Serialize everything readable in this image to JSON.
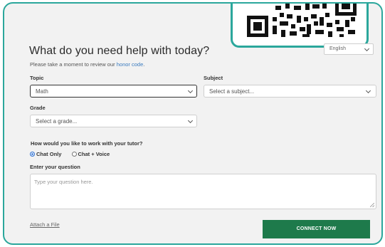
{
  "language": {
    "selected": "English"
  },
  "form": {
    "title": "What do you need help with today?",
    "subtitle_prefix": "Please take a moment to review our ",
    "honor_code_link": "honor code",
    "subtitle_suffix": ".",
    "topic": {
      "label": "Topic",
      "value": "Math"
    },
    "subject": {
      "label": "Subject",
      "value": "Select a subject..."
    },
    "grade": {
      "label": "Grade",
      "value": "Select a grade..."
    },
    "tutor_mode": {
      "label": "How would you like to work with your tutor?",
      "options": [
        {
          "label": "Chat Only",
          "checked": true
        },
        {
          "label": "Chat + Voice",
          "checked": false
        }
      ]
    },
    "question": {
      "label": "Enter your question",
      "placeholder": "Type your question here."
    },
    "attach_label": "Attach a File",
    "connect_label": "CONNECT NOW"
  },
  "colors": {
    "frame_border": "#2ba79c",
    "connect_button": "#1e7a4b",
    "link": "#3a7bbf",
    "radio_selected": "#2c6fd1"
  },
  "icons": [
    "qr-code-icon",
    "chevron-down-icon"
  ]
}
